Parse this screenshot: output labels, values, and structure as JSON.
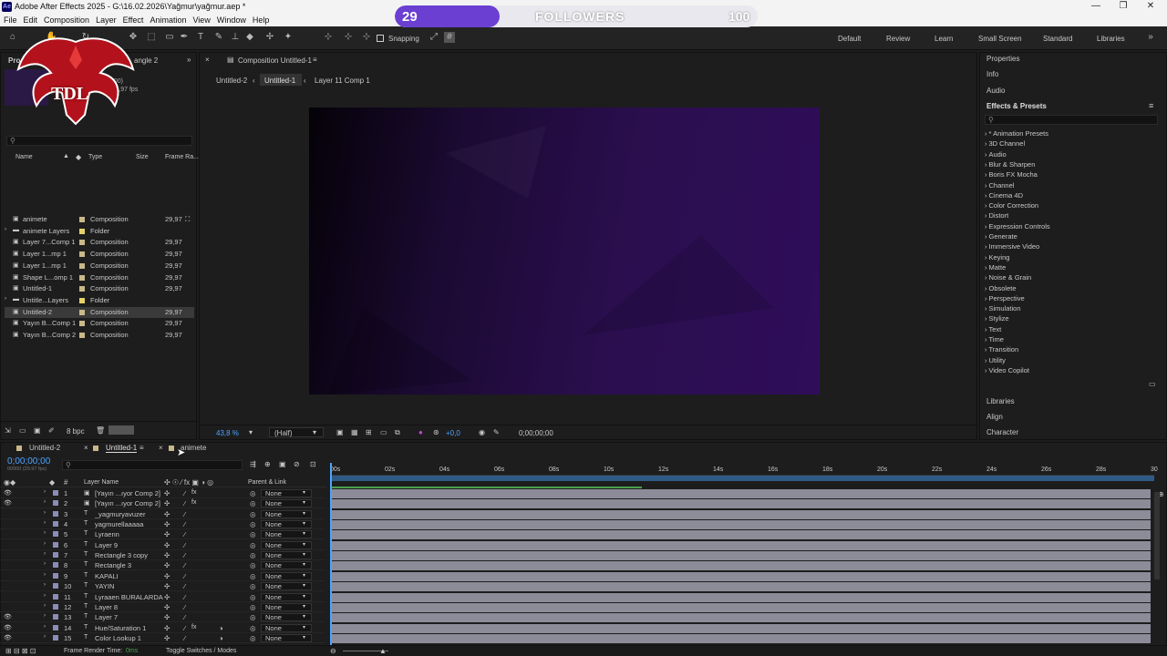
{
  "window": {
    "title": "Adobe After Effects 2025 - G:\\16.02.2026\\Yağmur\\yağmur.aep *",
    "icon": "Ae",
    "controls": [
      "—",
      "❐",
      "✕"
    ]
  },
  "menu": [
    "File",
    "Edit",
    "Composition",
    "Layer",
    "Effect",
    "Animation",
    "View",
    "Window",
    "Help"
  ],
  "overlay": {
    "current": "29",
    "label": "FOLLOWERS",
    "target": "100",
    "progress": 0.29,
    "fill_color": "#6a3fd1",
    "logo_text": "TDL"
  },
  "toolbar": {
    "snapping": "Snapping",
    "workspaces": [
      "Default",
      "Review",
      "Learn",
      "Small Screen",
      "Standard",
      "Libraries"
    ]
  },
  "project": {
    "tab": "Pro",
    "tab2": "angle 2",
    "info1": "0,00)",
    "info2": "0:00, 29,97 fps",
    "search_icon": "search-icon",
    "columns": [
      "Name",
      "Type",
      "Size",
      "Frame Ra..."
    ],
    "items": [
      {
        "name": "animete",
        "type": "Composition",
        "fr": "29,97",
        "color": "#c8b88a"
      },
      {
        "name": "animete Layers",
        "type": "Folder",
        "fr": "",
        "color": "#e5d16a"
      },
      {
        "name": "Layer 7...Comp 1",
        "type": "Composition",
        "fr": "29,97",
        "color": "#c8b88a"
      },
      {
        "name": "Layer 1...mp 1",
        "type": "Composition",
        "fr": "29,97",
        "color": "#c8b88a"
      },
      {
        "name": "Layer 1...mp 1",
        "type": "Composition",
        "fr": "29,97",
        "color": "#c8b88a"
      },
      {
        "name": "Shape L...omp 1",
        "type": "Composition",
        "fr": "29,97",
        "color": "#c8b88a"
      },
      {
        "name": "Untitled-1",
        "type": "Composition",
        "fr": "29,97",
        "color": "#c8b88a"
      },
      {
        "name": "Untitle...Layers",
        "type": "Folder",
        "fr": "",
        "color": "#e5d16a"
      },
      {
        "name": "Untitled-2",
        "type": "Composition",
        "fr": "29,97",
        "color": "#c8b88a"
      },
      {
        "name": "Yayın B...Comp 1",
        "type": "Composition",
        "fr": "29,97",
        "color": "#c8b88a"
      },
      {
        "name": "Yayın B...Comp 2",
        "type": "Composition",
        "fr": "29,97",
        "color": "#c8b88a"
      }
    ],
    "bpc": "8 bpc"
  },
  "composition": {
    "panel_title": "Composition Untitled-1",
    "flow": [
      "Untitled-2",
      "Untitled-1",
      "Layer 11 Comp 1"
    ],
    "zoom": "43,8 %",
    "resolution": "(Half)",
    "exposure": "+0,0",
    "timecode": "0;00;00;00"
  },
  "right": {
    "sections_top": [
      "Properties",
      "Info",
      "Audio"
    ],
    "effects_title": "Effects & Presets",
    "effects": [
      "* Animation Presets",
      "3D Channel",
      "Audio",
      "Blur & Sharpen",
      "Boris FX Mocha",
      "Channel",
      "Cinema 4D",
      "Color Correction",
      "Distort",
      "Expression Controls",
      "Generate",
      "Immersive Video",
      "Keying",
      "Matte",
      "Noise & Grain",
      "Obsolete",
      "Perspective",
      "Simulation",
      "Stylize",
      "Text",
      "Time",
      "Transition",
      "Utility",
      "Video Copilot"
    ],
    "sections_bottom": [
      "Libraries",
      "Align",
      "Character"
    ]
  },
  "timeline": {
    "tabs": [
      "Untitled-2",
      "Untitled-1",
      "animete"
    ],
    "timecode": "0;00;00;00",
    "fps_note": "00000 (29.97 fps)",
    "col_layer": "Layer Name",
    "col_parent": "Parent & Link",
    "ticks": [
      "00s",
      "02s",
      "04s",
      "06s",
      "08s",
      "10s",
      "12s",
      "14s",
      "16s",
      "18s",
      "20s",
      "22s",
      "24s",
      "26s",
      "28s",
      "30"
    ],
    "layers": [
      {
        "n": "1",
        "name": "[Yayın ...ıyor Comp 2]",
        "parent": "None",
        "fx": true,
        "eye": true
      },
      {
        "n": "2",
        "name": "[Yayın ...ıyor Comp 2]",
        "parent": "None",
        "fx": true,
        "eye": true
      },
      {
        "n": "3",
        "name": "_yagmuryavuzer",
        "parent": "None",
        "fx": false,
        "eye": false
      },
      {
        "n": "4",
        "name": "yagmurellaaaaa",
        "parent": "None",
        "fx": false,
        "eye": false
      },
      {
        "n": "5",
        "name": "Lyraenn",
        "parent": "None",
        "fx": false,
        "eye": false
      },
      {
        "n": "6",
        "name": "Layer 9",
        "parent": "None",
        "fx": false,
        "eye": false
      },
      {
        "n": "7",
        "name": "Rectangle 3 copy",
        "parent": "None",
        "fx": false,
        "eye": false
      },
      {
        "n": "8",
        "name": "Rectangle 3",
        "parent": "None",
        "fx": false,
        "eye": false
      },
      {
        "n": "9",
        "name": "KAPALI",
        "parent": "None",
        "fx": false,
        "eye": false
      },
      {
        "n": "10",
        "name": "YAYIN",
        "parent": "None",
        "fx": false,
        "eye": false
      },
      {
        "n": "11",
        "name": "Lyraaen BURALARDA",
        "parent": "None",
        "fx": false,
        "eye": false
      },
      {
        "n": "12",
        "name": "Layer 8",
        "parent": "None",
        "fx": false,
        "eye": false
      },
      {
        "n": "13",
        "name": "Layer 7",
        "parent": "None",
        "fx": false,
        "eye": true
      },
      {
        "n": "14",
        "name": "Hue/Saturation 1",
        "parent": "None",
        "fx": true,
        "eye": true
      },
      {
        "n": "15",
        "name": "Color Lookup 1",
        "parent": "None",
        "fx": false,
        "eye": true
      }
    ],
    "footer_render": "Frame Render Time:",
    "footer_render_val": "0ms",
    "footer_toggle": "Toggle Switches / Modes"
  }
}
